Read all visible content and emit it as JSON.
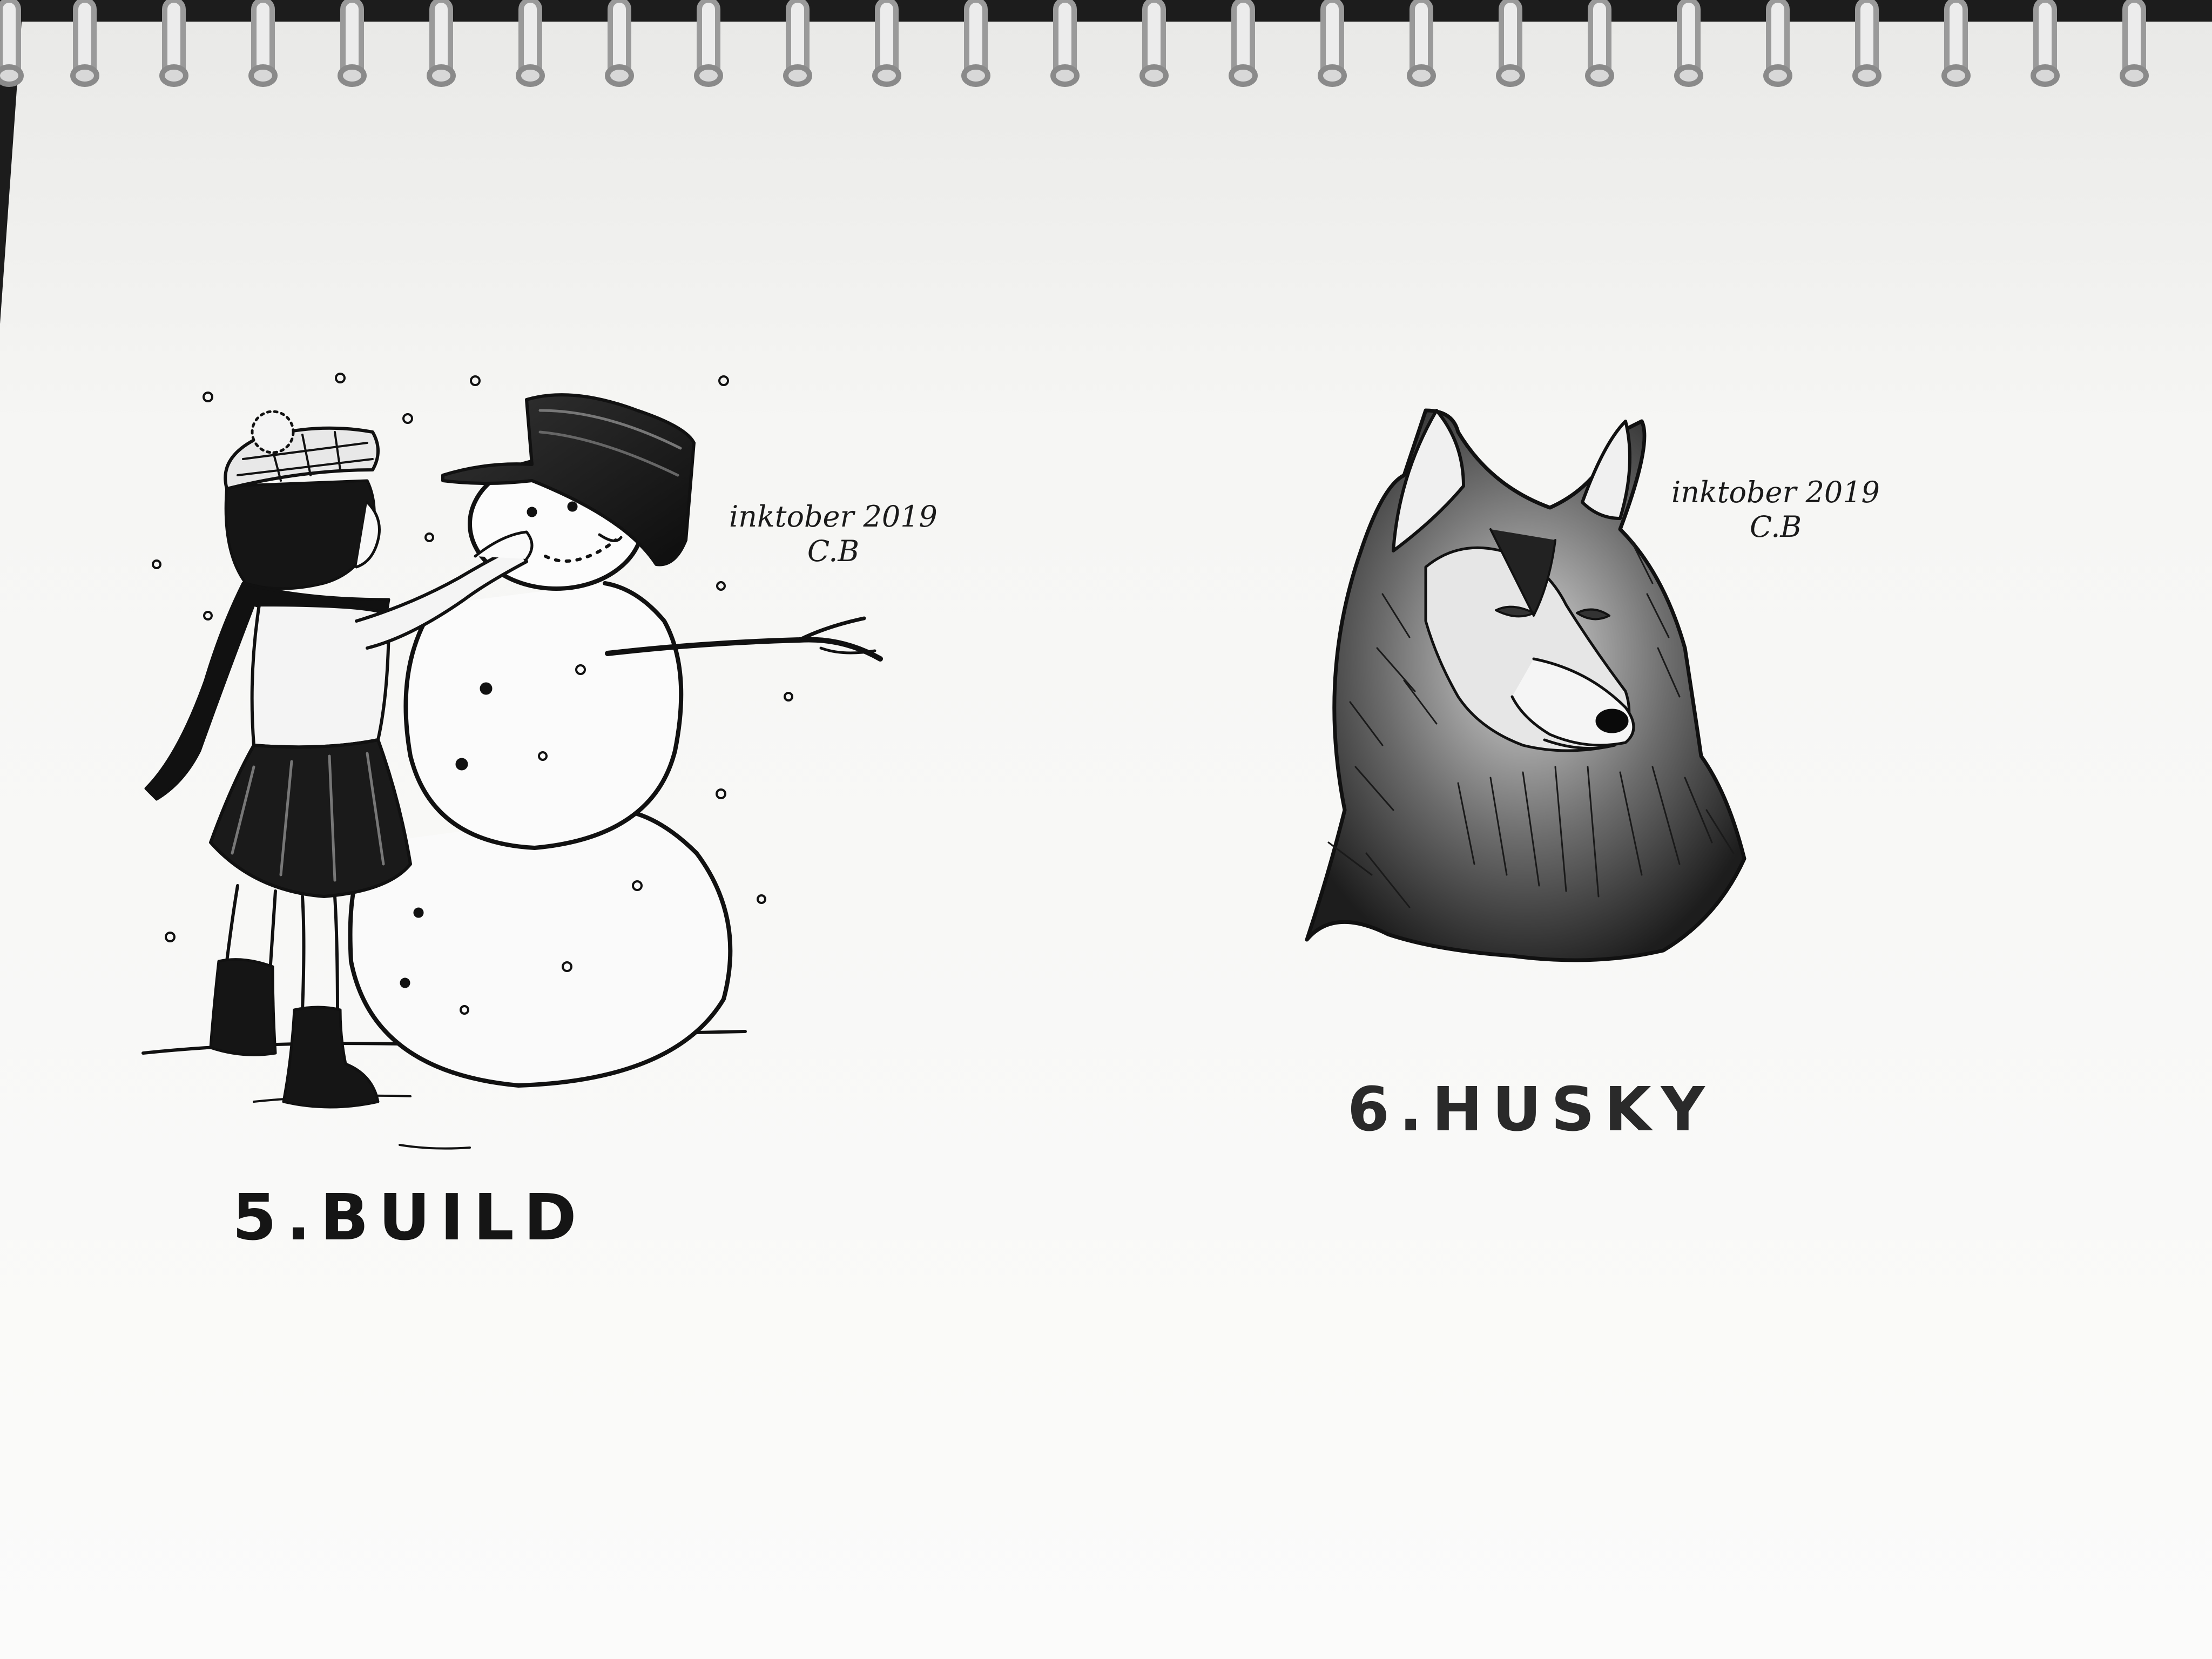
{
  "page": {
    "paper_color": "#f6f6f4",
    "ink_color": "#111111"
  },
  "left_drawing": {
    "caption": "5.BUILD",
    "signature_line1": "inktober 2019",
    "signature_line2": "C.B"
  },
  "right_drawing": {
    "caption": "6.HUSKY",
    "signature_line1": "inktober 2019",
    "signature_line2": "C.B"
  }
}
